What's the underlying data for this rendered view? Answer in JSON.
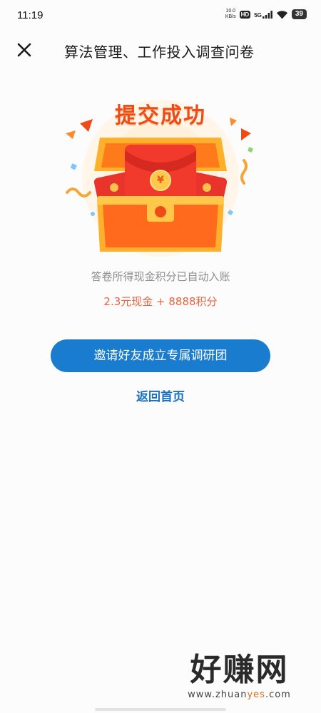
{
  "status_bar": {
    "time": "11:19",
    "net_speed_value": "10.0",
    "net_speed_unit": "KB/s",
    "hd": "HD",
    "network": "5G",
    "battery": "39"
  },
  "header": {
    "title": "算法管理、工作投入调查问卷",
    "close_icon": "close-icon"
  },
  "illustration": {
    "title": "提交成功",
    "coin_symbol": "¥",
    "icon": "treasure-chest-red-envelope"
  },
  "result": {
    "notice": "答卷所得现金积分已自动入账",
    "reward": "2.3元现金 + 8888积分"
  },
  "actions": {
    "invite_label": "邀请好友成立专属调研团",
    "back_label": "返回首页"
  },
  "watermark": {
    "brand": "好赚网",
    "url_pre": "www.zhuan",
    "url_hl": "yes",
    "url_post": ".com"
  },
  "colors": {
    "primary": "#1a7ccf",
    "link": "#1a6fbf",
    "reward": "#e8643f",
    "success_title": "#f04a17"
  }
}
